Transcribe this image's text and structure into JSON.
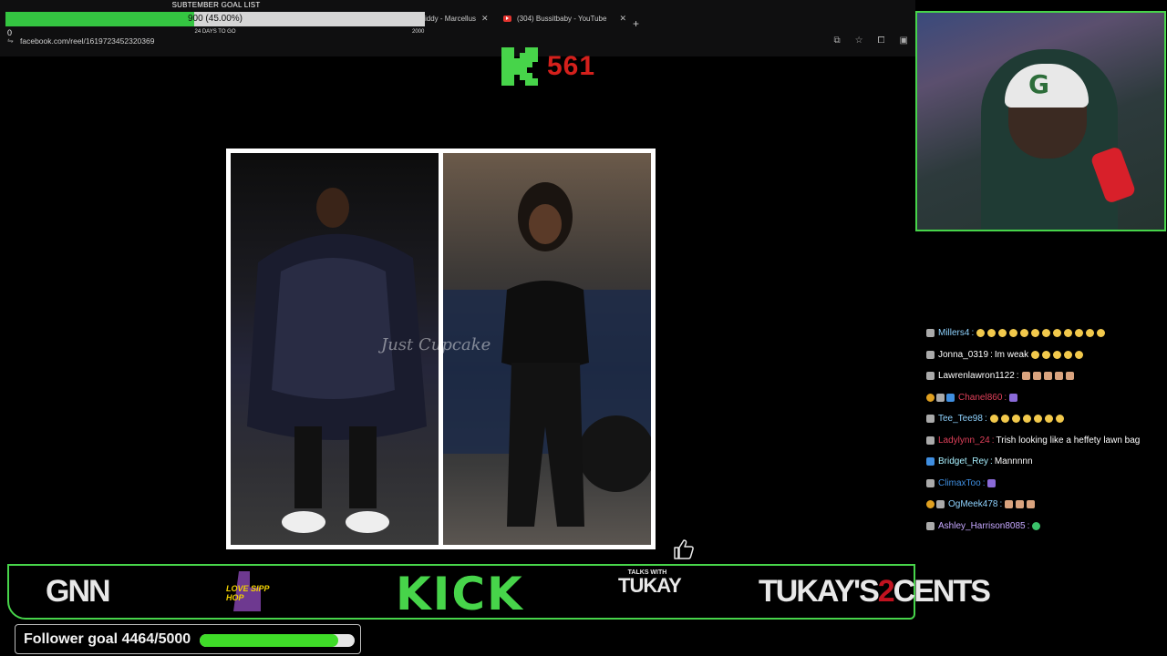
{
  "browser": {
    "tabs": [
      {
        "label": "iddy - Marcellus",
        "icon": "generic-tab-icon"
      },
      {
        "label": "(304) Bussitbaby - YouTube",
        "icon": "youtube-icon"
      }
    ],
    "new_tab_symbol": "+",
    "url": "facebook.com/reel/1619723452320369"
  },
  "goal": {
    "title": "SUBTEMBER GOAL LIST",
    "percent_text": "900 (45.00%)",
    "progress_fraction": 0.45,
    "min": "0",
    "days_left": "24 DAYS TO GO",
    "max": "2000"
  },
  "kick_counter": {
    "logo_letter": "K",
    "value": "561"
  },
  "video": {
    "watermark": "Just Cupcake"
  },
  "chat": [
    {
      "user": "Millers4",
      "user_color": "#8fd3ff",
      "badges": [
        "gray"
      ],
      "message": "",
      "emotes": [
        "joy",
        "joy",
        "joy",
        "joy",
        "joy",
        "joy",
        "joy",
        "joy",
        "joy",
        "joy",
        "joy",
        "joy"
      ]
    },
    {
      "user": "Jonna_0319",
      "user_color": "#ffffff",
      "badges": [
        "gray"
      ],
      "message": "Im weak",
      "emotes": [
        "joy",
        "joy",
        "joy",
        "joy",
        "joy"
      ]
    },
    {
      "user": "Lawrenlawron1122",
      "user_color": "#ffffff",
      "badges": [
        "gray"
      ],
      "message": "",
      "emotes": [
        "face",
        "face",
        "face",
        "face",
        "face"
      ]
    },
    {
      "user": "Chanel860",
      "user_color": "#e0405a",
      "badges": [
        "coin",
        "gray",
        "blue"
      ],
      "message": "",
      "emotes": [
        "purple"
      ]
    },
    {
      "user": "Tee_Tee98",
      "user_color": "#8fd3ff",
      "badges": [
        "gray"
      ],
      "message": "",
      "emotes": [
        "joy",
        "joy",
        "joy",
        "joy",
        "joy",
        "joy",
        "joy"
      ]
    },
    {
      "user": "Ladylynn_24",
      "user_color": "#e0405a",
      "badges": [
        "gray"
      ],
      "message": "Trish looking like a heffety lawn bag",
      "emotes": []
    },
    {
      "user": "Bridget_Rey",
      "user_color": "#a8f0ff",
      "badges": [
        "blue"
      ],
      "message": "Mannnnn",
      "emotes": []
    },
    {
      "user": "ClimaxToo",
      "user_color": "#3f8ee0",
      "badges": [
        "gray"
      ],
      "message": "",
      "emotes": [
        "purple"
      ]
    },
    {
      "user": "OgMeek478",
      "user_color": "#8fd3ff",
      "badges": [
        "coin",
        "gray"
      ],
      "message": "",
      "emotes": [
        "face",
        "face",
        "face"
      ]
    },
    {
      "user": "Ashley_Harrison8085",
      "user_color": "#c6a8ff",
      "badges": [
        "gray"
      ],
      "message": "",
      "emotes": [
        "green"
      ]
    }
  ],
  "sponsors": {
    "gnn": "GNN",
    "love_hiphop": "LOVE SIPP HOP",
    "kick": "KICK",
    "talks_with": "TALKS WITH",
    "tukay": "TUKAY",
    "cents_left": "TUKAY'S",
    "cents_two": "2",
    "cents_right": "CENTS"
  },
  "follower_goal": {
    "label": "Follower goal 4464/5000",
    "current": 4464,
    "target": 5000
  },
  "colors": {
    "accent_green": "#47d44a",
    "kick_red": "#d4201c",
    "bar_fill": "#3fdc28"
  }
}
